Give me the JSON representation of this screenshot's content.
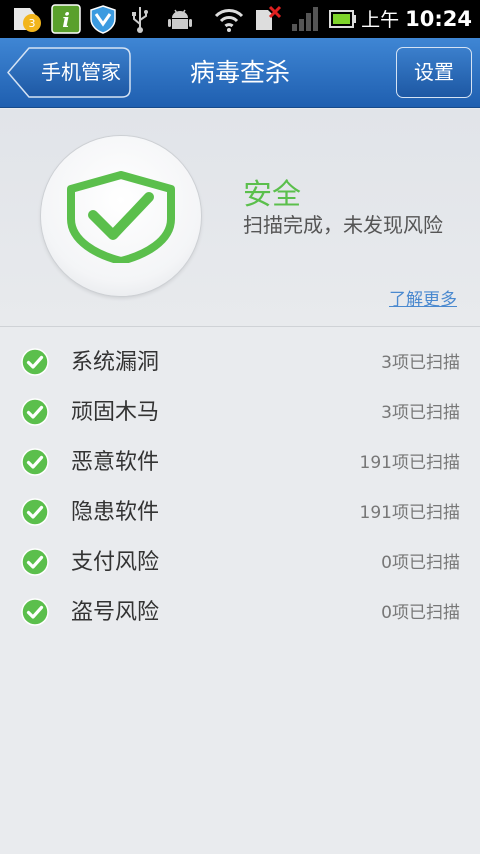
{
  "status_bar": {
    "badge_count": "3",
    "ampm": "上午",
    "time": "10:24"
  },
  "header": {
    "back_label": "手机管家",
    "title": "病毒查杀",
    "settings_label": "设置"
  },
  "summary": {
    "status": "安全",
    "description": "扫描完成，未发现风险",
    "learn_more": "了解更多"
  },
  "scan_items": [
    {
      "name": "系统漏洞",
      "count": "3项已扫描"
    },
    {
      "name": "顽固木马",
      "count": "3项已扫描"
    },
    {
      "name": "恶意软件",
      "count": "191项已扫描"
    },
    {
      "name": "隐患软件",
      "count": "191项已扫描"
    },
    {
      "name": "支付风险",
      "count": "0项已扫描"
    },
    {
      "name": "盗号风险",
      "count": "0项已扫描"
    }
  ],
  "colors": {
    "header_blue": "#2a6cc0",
    "safe_green": "#5bbf4c",
    "link_blue": "#4a89cf"
  }
}
